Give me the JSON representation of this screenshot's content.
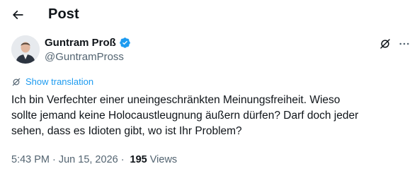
{
  "header": {
    "back_icon": "arrow-left-icon",
    "title": "Post"
  },
  "author": {
    "name": "Guntram Proß",
    "handle": "@GuntramPross",
    "verified_color": "#1d9bf0"
  },
  "actions": {
    "grok_icon": "grok-icon",
    "more_icon": "more-horizontal-icon"
  },
  "translation": {
    "label": "Show translation",
    "color": "#1d9bf0"
  },
  "tweet": {
    "lines": [
      "Ich bin Verfechter einer uneingeschränkten Meinungsfreiheit. Wieso",
      "sollte jemand keine Holocaustleugnung äußern dürfen? Darf doch jeder",
      "sehen, dass es Idioten gibt, wo ist Ihr Problem?"
    ]
  },
  "meta": {
    "time": "5:43 PM",
    "separator": "·",
    "date": "Jun 15, 2026",
    "views_count": "195",
    "views_label": "Views"
  }
}
